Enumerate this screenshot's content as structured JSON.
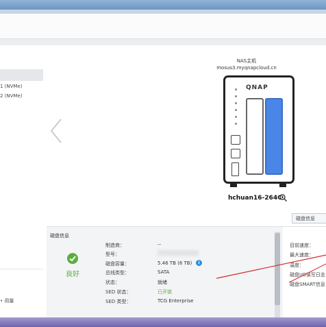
{
  "sidebar": {
    "items": [
      {
        "label": "1 (NVMe)"
      },
      {
        "label": "2 (NVMe)"
      }
    ],
    "bottom_label": "• 用量"
  },
  "nas": {
    "title": "NAS主机",
    "url": "mosus3.myqnapcloud.cn",
    "logo": "QNAP",
    "hostname": "hchuan16-264C"
  },
  "tab_disk_info": "磁盘信息",
  "disk_info": {
    "title": "磁盘信息",
    "status": "良好",
    "rows": [
      {
        "label": "制造商：",
        "value": "--"
      },
      {
        "label": "型号：",
        "value": ""
      },
      {
        "label": "磁盘容量：",
        "value": "5.46 TB (6 TB)"
      },
      {
        "label": "总线类型：",
        "value": "SATA"
      },
      {
        "label": "状态：",
        "value": "就绪"
      },
      {
        "label": "SED 状态：",
        "value": "已开锁"
      },
      {
        "label": "SED 类型：",
        "value": "TCG Enterprise"
      }
    ]
  },
  "right_panel": {
    "items": [
      {
        "label": "目前速度："
      },
      {
        "label": "最大速度："
      },
      {
        "label": "温度："
      },
      {
        "label": "磁盘I/O读写日志"
      },
      {
        "label": "磁盘SMART信息"
      }
    ]
  },
  "colors": {
    "accent_blue": "#2f7fd8",
    "ok_green": "#5cad3e",
    "annotation_red": "#d12b2b"
  }
}
